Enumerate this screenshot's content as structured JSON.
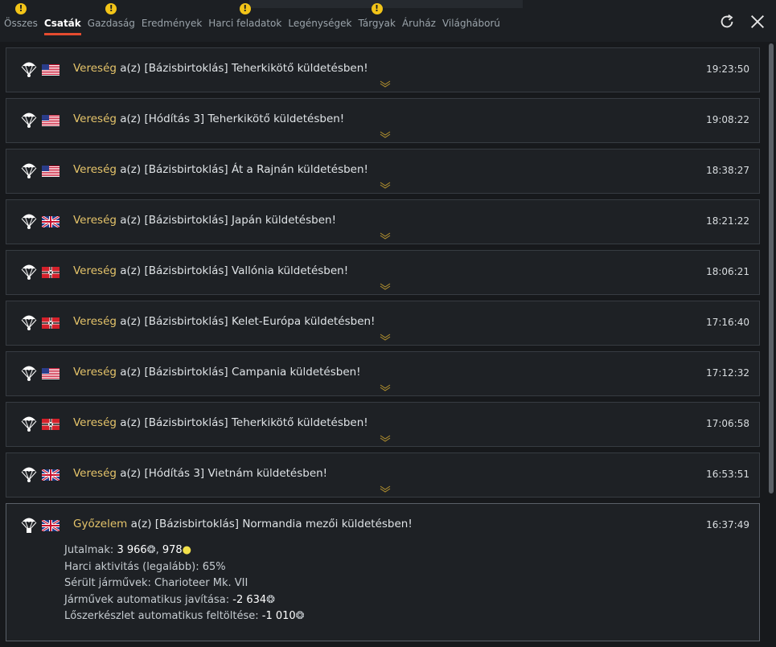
{
  "tabs": [
    {
      "label": "Összes",
      "badge": "!"
    },
    {
      "label": "Csaták",
      "badge": ""
    },
    {
      "label": "Gazdaság",
      "badge": "!"
    },
    {
      "label": "Eredmények",
      "badge": ""
    },
    {
      "label": "Harci feladatok",
      "badge": "!"
    },
    {
      "label": "Legénységek",
      "badge": ""
    },
    {
      "label": "Tárgyak",
      "badge": "!"
    },
    {
      "label": "Áruház",
      "badge": ""
    },
    {
      "label": "Világháború",
      "badge": ""
    }
  ],
  "active_tab": "Csaták",
  "icons": {
    "refresh": "refresh-icon",
    "close": "close-icon",
    "unit": "paratrooper-icon",
    "expand": "chevron-down-icon",
    "silver": "lion-icon",
    "rp": "bulb-icon"
  },
  "colors": {
    "accent": "#e44b2f",
    "result": "#e5c46a",
    "badge": "#f2c418"
  },
  "battles": [
    {
      "result": "Vereség",
      "text": " a(z) [Bázisbirtoklás] Teherkikötő küldetésben!",
      "time": "19:23:50",
      "flag": "usa"
    },
    {
      "result": "Vereség",
      "text": " a(z) [Hódítás 3] Teherkikötő küldetésben!",
      "time": "19:08:22",
      "flag": "usa"
    },
    {
      "result": "Vereség",
      "text": " a(z) [Bázisbirtoklás] Át a Rajnán küldetésben!",
      "time": "18:38:27",
      "flag": "usa"
    },
    {
      "result": "Vereség",
      "text": " a(z) [Bázisbirtoklás] Japán küldetésben!",
      "time": "18:21:22",
      "flag": "uk"
    },
    {
      "result": "Vereség",
      "text": " a(z) [Bázisbirtoklás] Vallónia küldetésben!",
      "time": "18:06:21",
      "flag": "germany"
    },
    {
      "result": "Vereség",
      "text": " a(z) [Bázisbirtoklás] Kelet-Európa küldetésben!",
      "time": "17:16:40",
      "flag": "germany"
    },
    {
      "result": "Vereség",
      "text": " a(z) [Bázisbirtoklás] Campania küldetésben!",
      "time": "17:12:32",
      "flag": "usa"
    },
    {
      "result": "Vereség",
      "text": " a(z) [Bázisbirtoklás] Teherkikötő küldetésben!",
      "time": "17:06:58",
      "flag": "germany"
    },
    {
      "result": "Vereség",
      "text": " a(z) [Hódítás 3] Vietnám küldetésben!",
      "time": "16:53:51",
      "flag": "uk"
    }
  ],
  "expanded": {
    "result": "Győzelem",
    "text": " a(z) [Bázisbirtoklás] Normandia mezői küldetésben!",
    "time": "16:37:49",
    "flag": "uk",
    "rewards_label": "Jutalmak:",
    "rewards_silver": "3 966",
    "rewards_sep": ",",
    "rewards_rp": "978",
    "activity": "Harci aktivitás (legalább): 65%",
    "damaged": "Sérült járművek: Charioteer Mk. VII",
    "repair_label": "Járművek automatikus javítása:",
    "repair_value": "-2 634",
    "ammo_label": "Lőszerkészlet automatikus feltöltése:",
    "ammo_value": "-1 010"
  }
}
